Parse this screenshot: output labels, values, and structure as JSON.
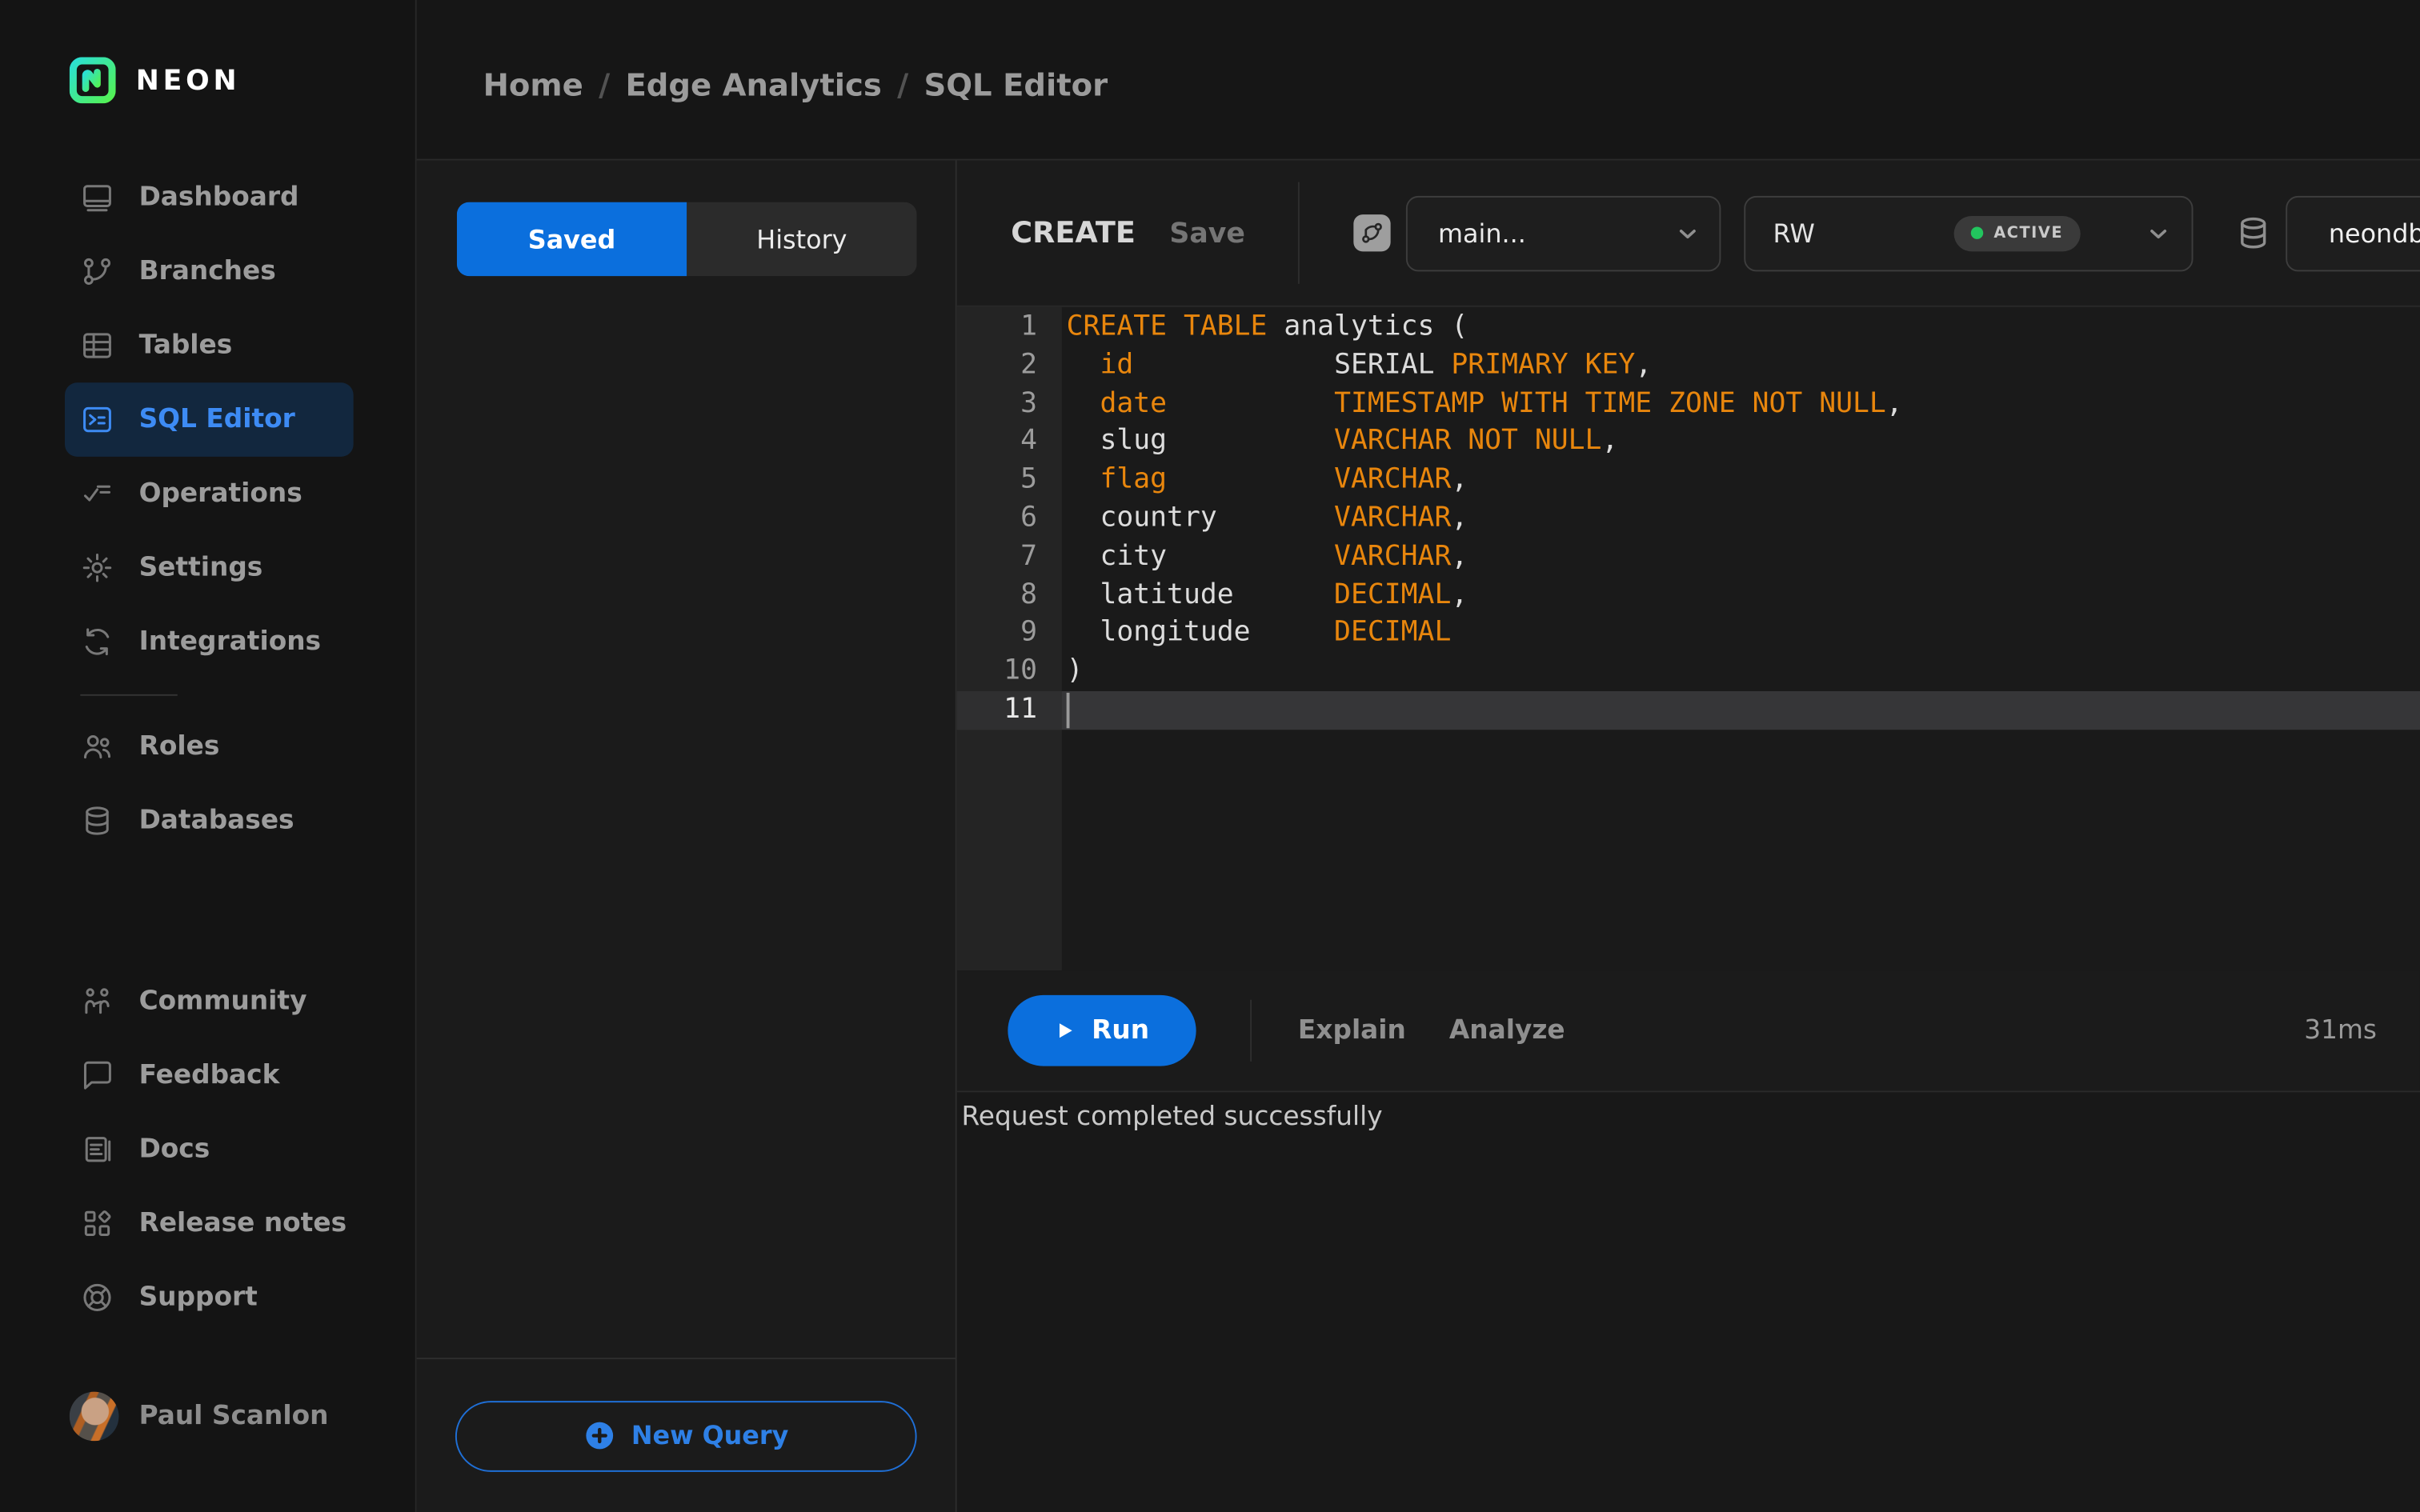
{
  "brand": {
    "name": "NEON"
  },
  "breadcrumb": {
    "items": [
      "Home",
      "Edge Analytics",
      "SQL Editor"
    ],
    "separator": "/"
  },
  "sidebar": {
    "nav_main": [
      {
        "label": "Dashboard",
        "icon": "dashboard",
        "active": false
      },
      {
        "label": "Branches",
        "icon": "branches",
        "active": false
      },
      {
        "label": "Tables",
        "icon": "tables",
        "active": false
      },
      {
        "label": "SQL Editor",
        "icon": "sql-editor",
        "active": true
      },
      {
        "label": "Operations",
        "icon": "operations",
        "active": false
      },
      {
        "label": "Settings",
        "icon": "settings",
        "active": false
      },
      {
        "label": "Integrations",
        "icon": "integrations",
        "active": false
      }
    ],
    "nav_secondary": [
      {
        "label": "Roles",
        "icon": "roles",
        "active": false
      },
      {
        "label": "Databases",
        "icon": "databases",
        "active": false
      }
    ],
    "nav_bottom": [
      {
        "label": "Community",
        "icon": "community",
        "active": false
      },
      {
        "label": "Feedback",
        "icon": "feedback",
        "active": false
      },
      {
        "label": "Docs",
        "icon": "docs",
        "active": false
      },
      {
        "label": "Release notes",
        "icon": "release-notes",
        "active": false
      },
      {
        "label": "Support",
        "icon": "support",
        "active": false
      }
    ],
    "user": {
      "name": "Paul Scanlon"
    }
  },
  "queries_panel": {
    "tabs": [
      {
        "label": "Saved",
        "active": true
      },
      {
        "label": "History",
        "active": false
      }
    ],
    "new_query_label": "New Query"
  },
  "editor": {
    "query_tab": "CREATE",
    "save_label": "Save",
    "branch": {
      "value": "main..."
    },
    "compute": {
      "value": "RW",
      "status": "ACTIVE"
    },
    "database": {
      "value": "neondb"
    },
    "code": {
      "active_line": 11,
      "lines": [
        {
          "n": 1,
          "tokens": [
            {
              "text": "CREATE TABLE",
              "type": "keyword"
            },
            {
              "text": " analytics (",
              "type": "plain"
            }
          ]
        },
        {
          "n": 2,
          "tokens": [
            {
              "text": "  ",
              "type": "plain"
            },
            {
              "text": "id",
              "type": "keyword"
            },
            {
              "text": "            SERIAL ",
              "type": "plain"
            },
            {
              "text": "PRIMARY KEY",
              "type": "keyword"
            },
            {
              "text": ",",
              "type": "plain"
            }
          ]
        },
        {
          "n": 3,
          "tokens": [
            {
              "text": "  ",
              "type": "plain"
            },
            {
              "text": "date",
              "type": "keyword"
            },
            {
              "text": "          ",
              "type": "plain"
            },
            {
              "text": "TIMESTAMP WITH TIME ZONE NOT NULL",
              "type": "keyword"
            },
            {
              "text": ",",
              "type": "plain"
            }
          ]
        },
        {
          "n": 4,
          "tokens": [
            {
              "text": "  slug          ",
              "type": "plain"
            },
            {
              "text": "VARCHAR NOT NULL",
              "type": "keyword"
            },
            {
              "text": ",",
              "type": "plain"
            }
          ]
        },
        {
          "n": 5,
          "tokens": [
            {
              "text": "  ",
              "type": "plain"
            },
            {
              "text": "flag",
              "type": "keyword"
            },
            {
              "text": "          ",
              "type": "plain"
            },
            {
              "text": "VARCHAR",
              "type": "keyword"
            },
            {
              "text": ",",
              "type": "plain"
            }
          ]
        },
        {
          "n": 6,
          "tokens": [
            {
              "text": "  country       ",
              "type": "plain"
            },
            {
              "text": "VARCHAR",
              "type": "keyword"
            },
            {
              "text": ",",
              "type": "plain"
            }
          ]
        },
        {
          "n": 7,
          "tokens": [
            {
              "text": "  city          ",
              "type": "plain"
            },
            {
              "text": "VARCHAR",
              "type": "keyword"
            },
            {
              "text": ",",
              "type": "plain"
            }
          ]
        },
        {
          "n": 8,
          "tokens": [
            {
              "text": "  latitude      ",
              "type": "plain"
            },
            {
              "text": "DECIMAL",
              "type": "keyword"
            },
            {
              "text": ",",
              "type": "plain"
            }
          ]
        },
        {
          "n": 9,
          "tokens": [
            {
              "text": "  longitude     ",
              "type": "plain"
            },
            {
              "text": "DECIMAL",
              "type": "keyword"
            }
          ]
        },
        {
          "n": 10,
          "tokens": [
            {
              "text": ")",
              "type": "plain"
            }
          ]
        },
        {
          "n": 11,
          "tokens": [],
          "active": true,
          "cursor": true
        }
      ]
    },
    "actions": {
      "run": "Run",
      "explain": "Explain",
      "analyze": "Analyze",
      "duration": "31ms"
    },
    "result_message": "Request completed successfully"
  },
  "colors": {
    "accent_blue": "#0b6fdd",
    "nav_active_blue": "#3d8bf4",
    "keyword_orange": "#e8860d",
    "status_green": "#22c55e",
    "logo_gradient": [
      "#2bdfd4",
      "#54f252"
    ]
  }
}
